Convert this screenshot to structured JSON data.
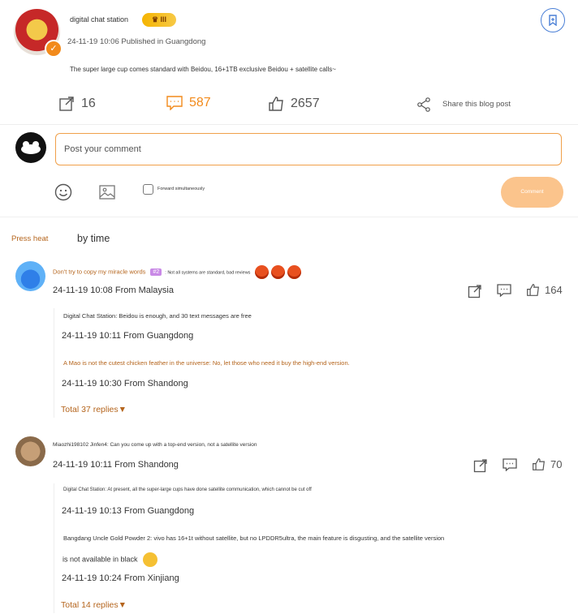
{
  "post": {
    "author": "digital chat station",
    "level_badge": "III",
    "meta": "24-11-19 10:06 Published in Guangdong",
    "content": "The super large cup comes standard with Beidou, 16+1TB exclusive Beidou + satellite calls~",
    "stats": {
      "reposts": "16",
      "comments": "587",
      "likes": "2657",
      "share_label": "Share this blog post"
    }
  },
  "composer": {
    "placeholder": "Post your comment",
    "forward_label": "Forward simultaneously",
    "submit_label": "Comment"
  },
  "sort_tabs": {
    "heat": "Press heat",
    "time": "by time"
  },
  "comments": [
    {
      "user": "Don't try to copy my miracle words",
      "rank_tag": "#2",
      "text": ": Not all systems are standard, bad reviews",
      "meta": "24-11-19 10:08 From Malaysia",
      "likes": "164",
      "replies": [
        {
          "text": "Digital Chat Station: Beidou is enough, and 30 text messages are free",
          "meta": "24-11-19 10:11 From Guangdong"
        },
        {
          "text": "A Mao is not the cutest chicken feather in the universe: No, let those who need it buy the high-end version.",
          "meta": "24-11-19 10:30 From Shandong"
        }
      ],
      "total_replies": "Total 37 replies▼"
    },
    {
      "user": "Miaozhi198102 Jinfen4",
      "text": ": Can you come up with a top-end version, not a satellite version",
      "meta": "24-11-19 10:11 From Shandong",
      "likes": "70",
      "replies": [
        {
          "text": "Digital Chat Station: At present, all the super-large cups have done satellite communication, which cannot be cut off",
          "meta": "24-11-19 10:13 From Guangdong"
        },
        {
          "text": "Bangdang Uncle Gold Powder 2: vivo has 16+1t without satellite, but no LPDDR5ultra, the main feature is disgusting, and the satellite version",
          "text2": "is not available in black",
          "meta": "24-11-19 10:24 From Xinjiang"
        }
      ],
      "total_replies": "Total 14 replies▼"
    }
  ],
  "colors": {
    "accent_orange": "#f28a1b",
    "link_brown": "#b5651d",
    "bookmark_blue": "#4a7fd6",
    "comment_button": "#fbc48c"
  }
}
